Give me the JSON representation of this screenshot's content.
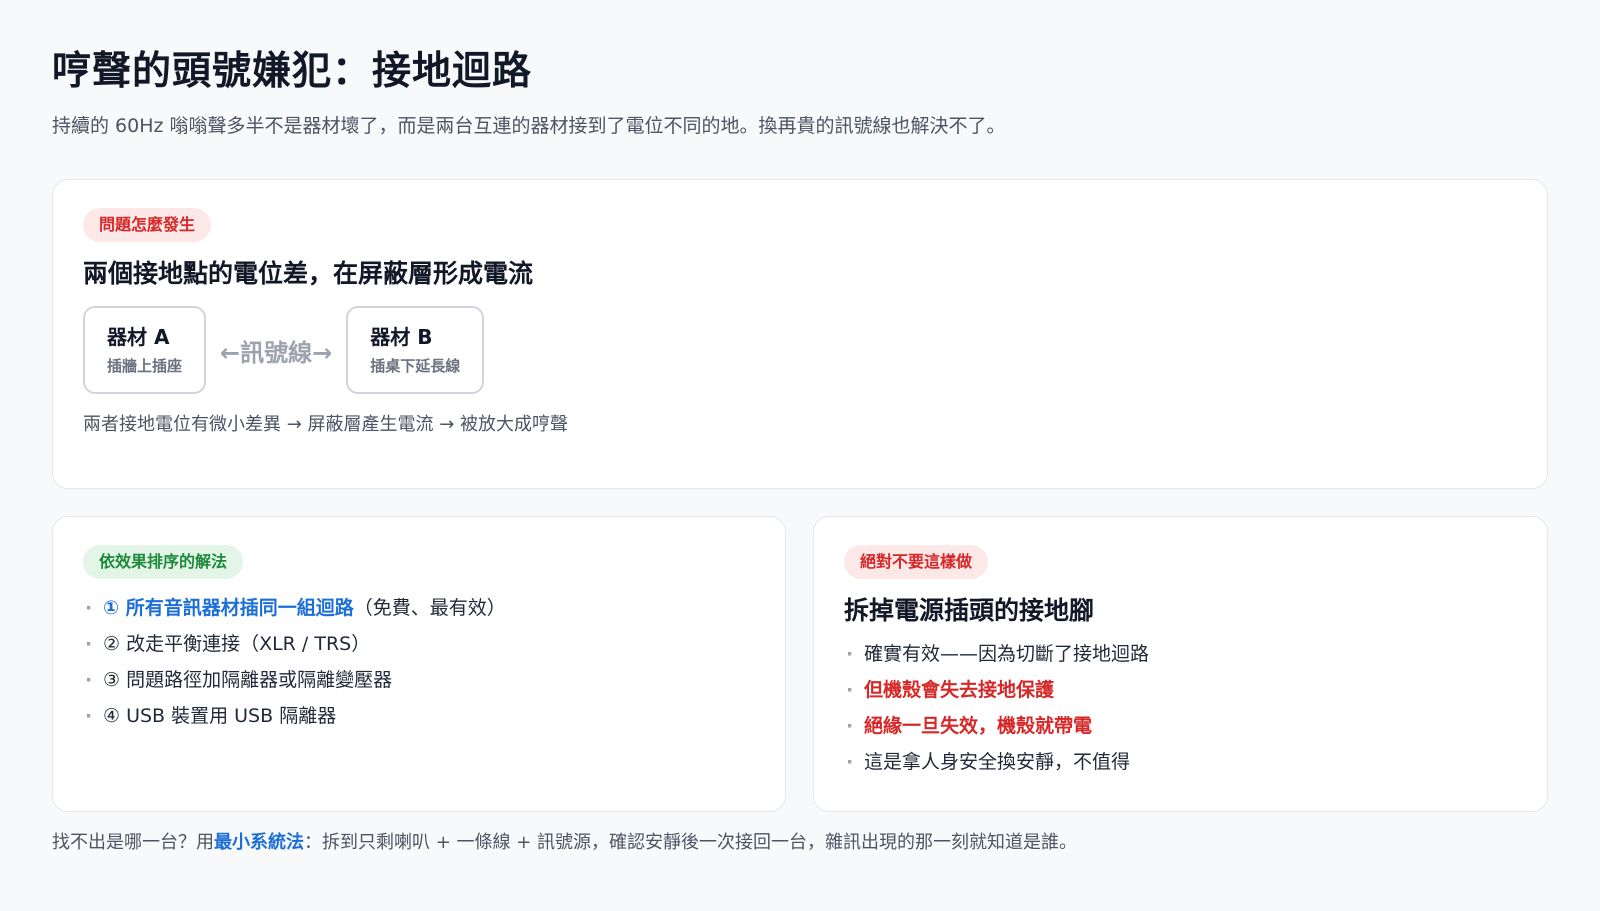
{
  "header": {
    "title": "哼聲的頭號嫌犯：接地迴路",
    "subtitle": "持續的 60Hz 嗡嗡聲多半不是器材壞了，而是兩台互連的器材接到了電位不同的地。換再貴的訊號線也解決不了。"
  },
  "how_it_happens": {
    "tag": "問題怎麼發生",
    "heading": "兩個接地點的電位差，在屏蔽層形成電流",
    "device_a": {
      "name": "器材 A",
      "note": "插牆上插座"
    },
    "cable": "←訊號線→",
    "device_b": {
      "name": "器材 B",
      "note": "插桌下延長線"
    },
    "caption": "兩者接地電位有微小差異 → 屏蔽層產生電流 → 被放大成哼聲"
  },
  "solutions": {
    "tag": "依效果排序的解法",
    "items": [
      {
        "highlight": "① 所有音訊器材插同一組迴路",
        "rest": "（免費、最有效）"
      },
      {
        "highlight": "",
        "rest": "② 改走平衡連接（XLR / TRS）"
      },
      {
        "highlight": "",
        "rest": "③ 問題路徑加隔離器或隔離變壓器"
      },
      {
        "highlight": "",
        "rest": "④ USB 裝置用 USB 隔離器"
      }
    ]
  },
  "dont": {
    "tag": "絕對不要這樣做",
    "heading": "拆掉電源插頭的接地腳",
    "items": [
      {
        "text": "確實有效——因為切斷了接地迴路",
        "warn": false
      },
      {
        "text": "但機殼會失去接地保護",
        "warn": true
      },
      {
        "text": "絕緣一旦失效，機殼就帶電",
        "warn": true
      },
      {
        "text": "這是拿人身安全換安靜，不值得",
        "warn": false
      }
    ]
  },
  "footer": {
    "prefix": "找不出是哪一台？用",
    "strong": "最小系統法",
    "suffix": "：拆到只剩喇叭 + 一條線 + 訊號源，確認安靜後一次接回一台，雜訊出現的那一刻就知道是誰。"
  },
  "colors": {
    "accent_blue": "#1d6fd8",
    "warn_red": "#d62828",
    "ok_green": "#1e8a3c"
  }
}
